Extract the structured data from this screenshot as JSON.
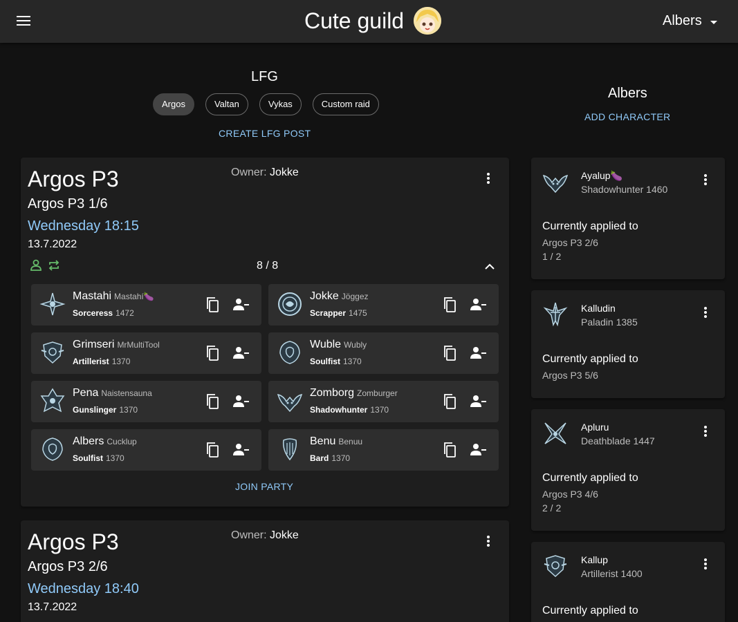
{
  "header": {
    "title": "Cute guild",
    "user": "Albers"
  },
  "lfg": {
    "title": "LFG",
    "chips": [
      {
        "label": "Argos",
        "selected": true
      },
      {
        "label": "Valtan",
        "selected": false
      },
      {
        "label": "Vykas",
        "selected": false
      },
      {
        "label": "Custom raid",
        "selected": false
      }
    ],
    "create_label": "CREATE LFG POST"
  },
  "posts": [
    {
      "title": "Argos P3",
      "subtitle": "Argos P3 1/6",
      "time": "Wednesday 18:15",
      "date": "13.7.2022",
      "owner_label": "Owner:",
      "owner": "Jokke",
      "count": "8 / 8",
      "join_label": "JOIN PARTY",
      "members": [
        {
          "name": "Mastahi",
          "alias": "Mastahí🍆",
          "class": "Sorceress",
          "ilvl": "1472",
          "icon": "sorceress-icon"
        },
        {
          "name": "Jokke",
          "alias": "Jöggez",
          "class": "Scrapper",
          "ilvl": "1475",
          "icon": "scrapper-icon"
        },
        {
          "name": "Grimseri",
          "alias": "MrMultiTool",
          "class": "Artillerist",
          "ilvl": "1370",
          "icon": "artillerist-icon"
        },
        {
          "name": "Wuble",
          "alias": "Wubly",
          "class": "Soulfist",
          "ilvl": "1370",
          "icon": "soulfist-icon"
        },
        {
          "name": "Pena",
          "alias": "Naistensauna",
          "class": "Gunslinger",
          "ilvl": "1370",
          "icon": "gunslinger-icon"
        },
        {
          "name": "Zomborg",
          "alias": "Zomburger",
          "class": "Shadowhunter",
          "ilvl": "1370",
          "icon": "shadowhunter-icon"
        },
        {
          "name": "Albers",
          "alias": "Cucklup",
          "class": "Soulfist",
          "ilvl": "1370",
          "icon": "soulfist-icon"
        },
        {
          "name": "Benu",
          "alias": "Benuu",
          "class": "Bard",
          "ilvl": "1370",
          "icon": "bard-icon"
        }
      ]
    },
    {
      "title": "Argos P3",
      "subtitle": "Argos P3 2/6",
      "time": "Wednesday 18:40",
      "date": "13.7.2022",
      "owner_label": "Owner:",
      "owner": "Jokke"
    }
  ],
  "characters": {
    "title": "Albers",
    "add_label": "ADD CHARACTER",
    "applied_label": "Currently applied to",
    "items": [
      {
        "name": "Ayalup🍆",
        "class_line": "Shadowhunter 1460",
        "icon": "shadowhunter-icon",
        "applied": [
          "Argos P3 2/6",
          "1 / 2"
        ]
      },
      {
        "name": "Kalludin",
        "class_line": "Paladin 1385",
        "icon": "paladin-icon",
        "applied": [
          "Argos P3 5/6"
        ]
      },
      {
        "name": "Apluru",
        "class_line": "Deathblade 1447",
        "icon": "deathblade-icon",
        "applied": [
          "Argos P3 4/6",
          "2 / 2"
        ]
      },
      {
        "name": "Kallup",
        "class_line": "Artillerist 1400",
        "icon": "artillerist-icon",
        "applied": []
      }
    ]
  },
  "colors": {
    "accent": "#90caf9",
    "status_green": "#66bb6a",
    "card": "#1e1e1e",
    "member_bg": "#2e2e2e"
  }
}
